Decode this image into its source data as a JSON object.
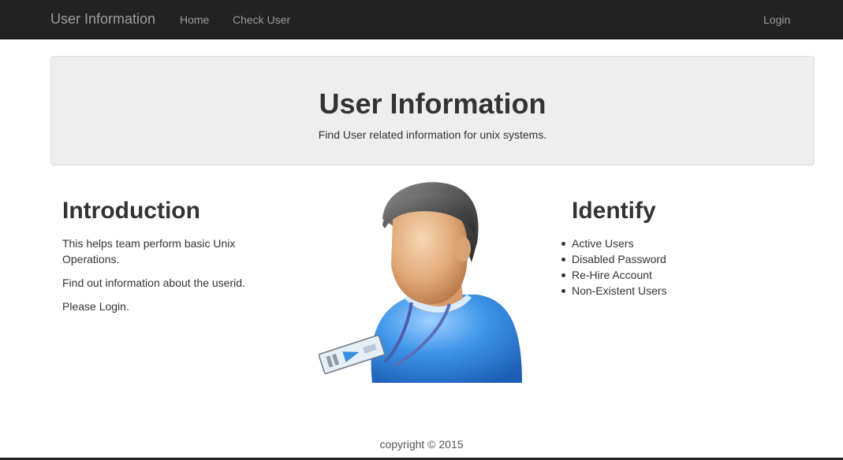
{
  "navbar": {
    "brand": "User Information",
    "links": [
      "Home",
      "Check User"
    ],
    "login": "Login"
  },
  "jumbotron": {
    "title": "User Information",
    "subtitle": "Find User related information for unix systems."
  },
  "introduction": {
    "heading": "Introduction",
    "paragraphs": [
      "This helps team perform basic Unix Operations.",
      "Find out information about the userid.",
      "Please Login."
    ]
  },
  "identify": {
    "heading": "Identify",
    "items": [
      "Active Users",
      "Disabled Password",
      "Re-Hire Account",
      "Non-Existent Users"
    ]
  },
  "footer": "copyright © 2015",
  "colors": {
    "navbar_bg": "#222222",
    "nav_text": "#9d9d9d",
    "jumbotron_bg": "#eeeeee",
    "text": "#333333",
    "shirt_blue": "#3a8fe0"
  },
  "icons": {
    "avatar": "user-with-badge-icon"
  }
}
